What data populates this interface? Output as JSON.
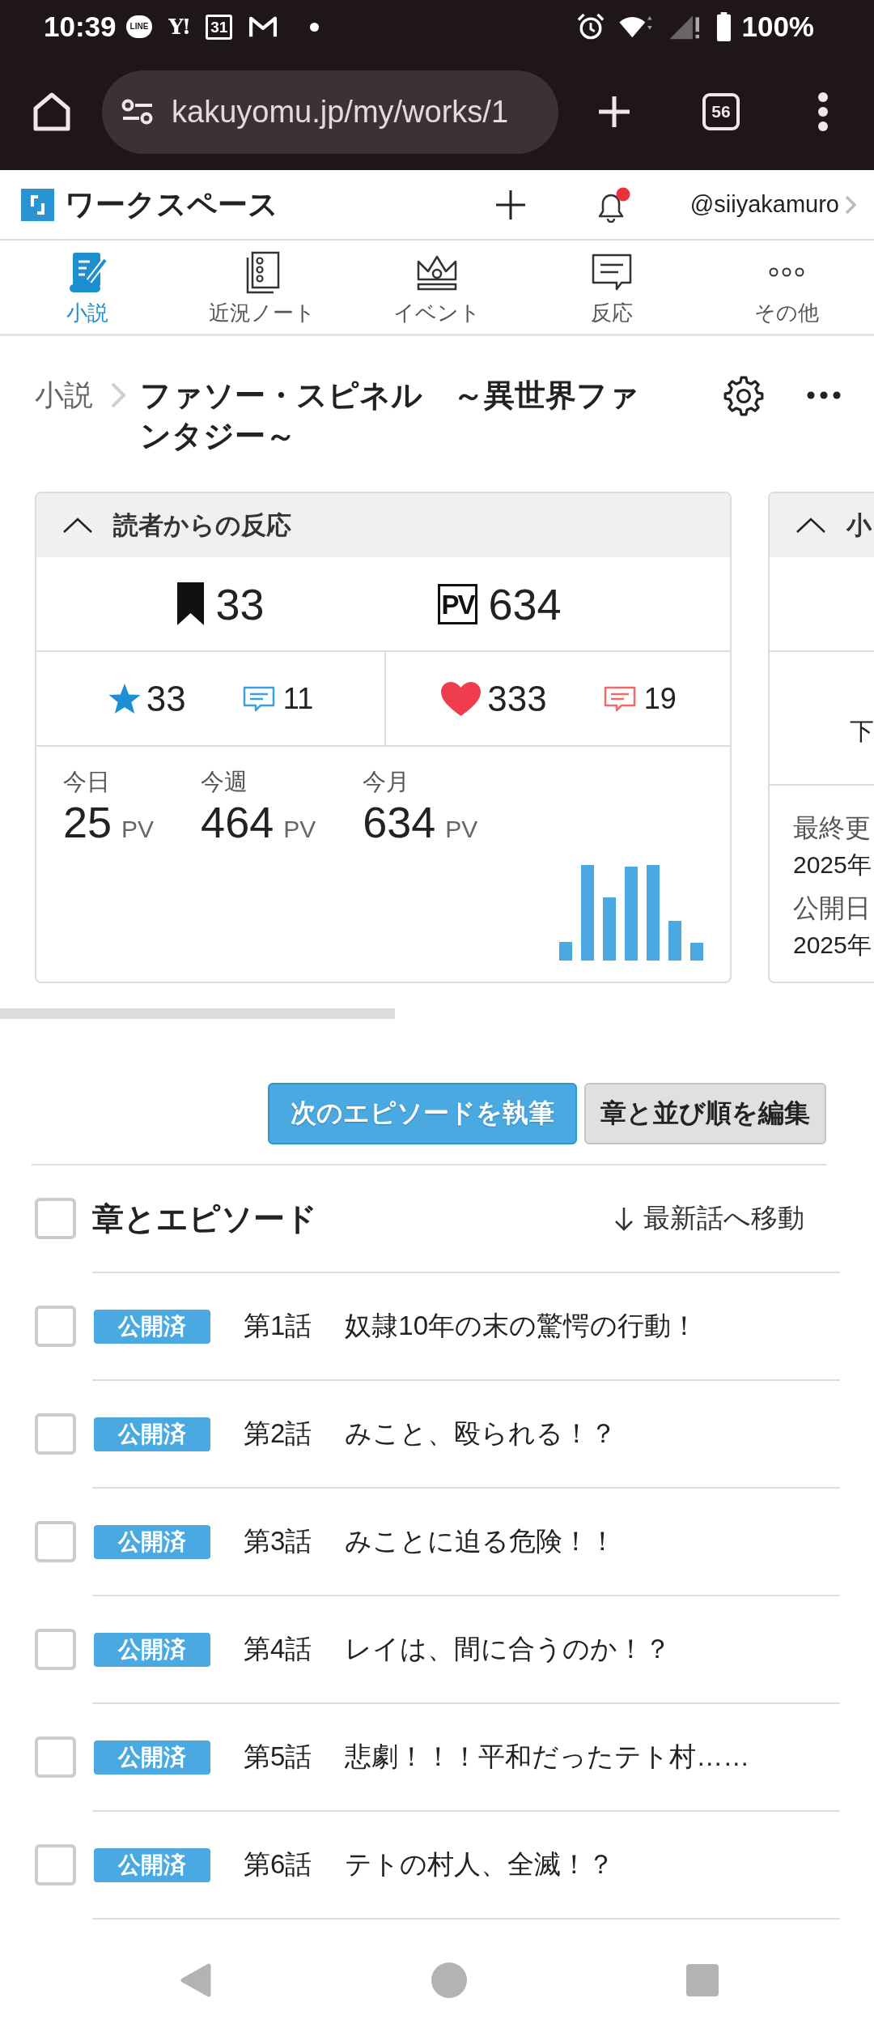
{
  "status_bar": {
    "time": "10:39",
    "notification_icons": [
      {
        "kind": "line",
        "label": "LINE"
      },
      {
        "kind": "yahoo",
        "label": "Y!"
      },
      {
        "kind": "calendar",
        "label": "31"
      },
      {
        "kind": "gmail"
      },
      {
        "kind": "dot"
      }
    ],
    "battery_text": "100%"
  },
  "browser": {
    "url": "kakuyomu.jp/my/works/1",
    "tab_count": "56"
  },
  "header": {
    "title": "ワークスペース",
    "username": "@siiyakamuro",
    "notification_unread": true
  },
  "nav_tabs": [
    {
      "kind": "novel",
      "label": "小説",
      "selected": true
    },
    {
      "kind": "notes",
      "label": "近況ノート",
      "selected": false
    },
    {
      "kind": "event",
      "label": "イベント",
      "selected": false
    },
    {
      "kind": "reaction",
      "label": "反応",
      "selected": false
    },
    {
      "kind": "more",
      "label": "その他",
      "selected": false
    }
  ],
  "breadcrumb": {
    "parent": "小説",
    "title": "ファソー・スピネル　～異世界ファンタジー～"
  },
  "reactions_card": {
    "title": "読者からの反応",
    "expanded": true,
    "totals": [
      {
        "kind": "bookmark",
        "count": "33"
      },
      {
        "kind": "pv",
        "label": "PV",
        "count": "634"
      }
    ],
    "ratings": [
      {
        "kind": "star",
        "count": "33",
        "comment_count": "11"
      },
      {
        "kind": "heart",
        "count": "333",
        "comment_count": "19"
      }
    ],
    "periods": [
      {
        "label": "今日",
        "value": "25",
        "unit": "PV"
      },
      {
        "label": "今週",
        "value": "464",
        "unit": "PV"
      },
      {
        "label": "今月",
        "value": "634",
        "unit": "PV"
      }
    ]
  },
  "info_card": {
    "title": "小",
    "expanded": true,
    "partial_text": "下",
    "fields": [
      {
        "label": "最終更",
        "value": "2025年"
      },
      {
        "label": "公開日",
        "value": "2025年"
      }
    ]
  },
  "actions": [
    {
      "kind": "primary",
      "label": "次のエピソードを執筆"
    },
    {
      "kind": "secondary",
      "label": "章と並び順を編集"
    }
  ],
  "episode_list": {
    "header": "章とエピソード",
    "header_checked": false,
    "jump_link": "最新話へ移動",
    "episodes": [
      {
        "badge": "公開済",
        "number": "第1話",
        "title": "奴隷10年の末の驚愕の行動！",
        "checked": false
      },
      {
        "badge": "公開済",
        "number": "第2話",
        "title": "みこと、殴られる！？",
        "checked": false
      },
      {
        "badge": "公開済",
        "number": "第3話",
        "title": "みことに迫る危険！！",
        "checked": false
      },
      {
        "badge": "公開済",
        "number": "第4話",
        "title": "レイは、間に合うのか！？",
        "checked": false
      },
      {
        "badge": "公開済",
        "number": "第5話",
        "title": "悲劇！！！平和だったテト村……",
        "checked": false
      },
      {
        "badge": "公開済",
        "number": "第6話",
        "title": "テトの村人、全滅！？",
        "checked": false
      }
    ]
  }
}
